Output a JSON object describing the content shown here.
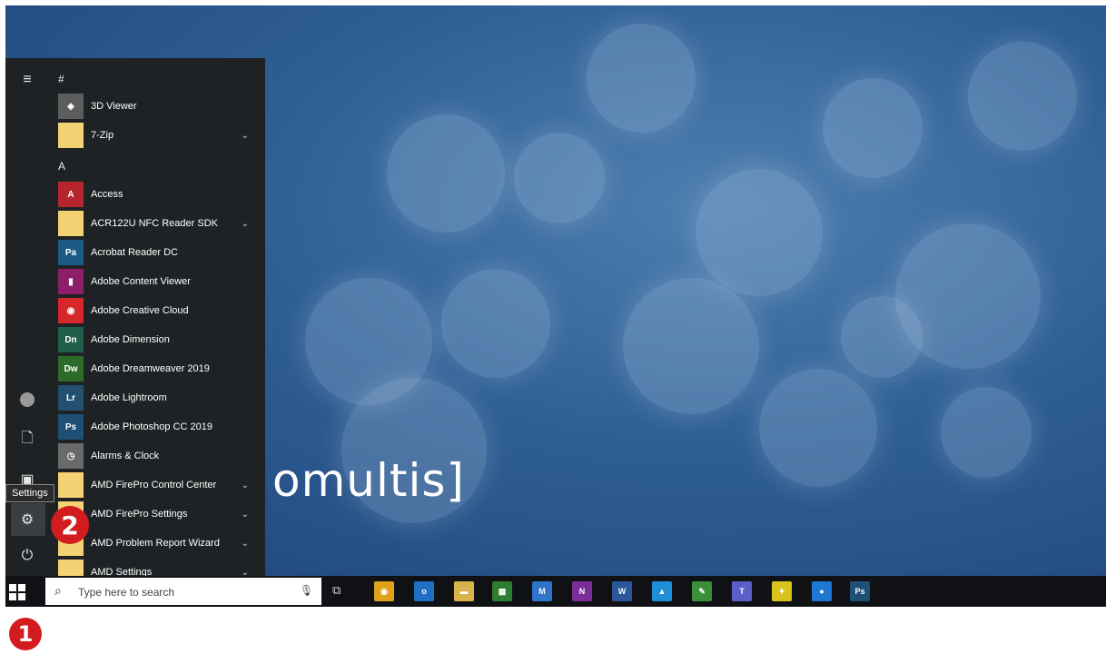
{
  "wallpaper": {
    "text": "omultis]"
  },
  "start_menu": {
    "rail": {
      "settings_tooltip": "Settings"
    },
    "groups": [
      {
        "header": "#",
        "apps": [
          {
            "label": "3D Viewer",
            "icon": "cube-icon",
            "color": "#5d5d5d",
            "glyph": "◈",
            "expandable": false
          },
          {
            "label": "7-Zip",
            "icon": "folder-icon",
            "color": "#f2d272",
            "glyph": "",
            "expandable": true
          }
        ]
      },
      {
        "header": "A",
        "apps": [
          {
            "label": "Access",
            "icon": "access-icon",
            "color": "#b7252c",
            "glyph": "A",
            "expandable": false
          },
          {
            "label": "ACR122U NFC Reader SDK",
            "icon": "folder-icon",
            "color": "#f2d272",
            "glyph": "",
            "expandable": true
          },
          {
            "label": "Acrobat Reader DC",
            "icon": "acrobat-icon",
            "color": "#1c5a86",
            "glyph": "Pa",
            "expandable": false
          },
          {
            "label": "Adobe Content Viewer",
            "icon": "content-viewer-icon",
            "color": "#8d1f6a",
            "glyph": "▮",
            "expandable": false
          },
          {
            "label": "Adobe Creative Cloud",
            "icon": "creative-cloud-icon",
            "color": "#d6272b",
            "glyph": "◉",
            "expandable": false
          },
          {
            "label": "Adobe Dimension",
            "icon": "dimension-icon",
            "color": "#1f5f4a",
            "glyph": "Dn",
            "expandable": false
          },
          {
            "label": "Adobe Dreamweaver 2019",
            "icon": "dreamweaver-icon",
            "color": "#2d6b2a",
            "glyph": "Dw",
            "expandable": false
          },
          {
            "label": "Adobe Lightroom",
            "icon": "lightroom-icon",
            "color": "#22506e",
            "glyph": "Lr",
            "expandable": false
          },
          {
            "label": "Adobe Photoshop CC 2019",
            "icon": "photoshop-icon",
            "color": "#1e4f75",
            "glyph": "Ps",
            "expandable": false
          },
          {
            "label": "Alarms & Clock",
            "icon": "clock-icon",
            "color": "#6a6a6a",
            "glyph": "◷",
            "expandable": false
          },
          {
            "label": "AMD FirePro Control Center",
            "icon": "folder-icon",
            "color": "#f2d272",
            "glyph": "",
            "expandable": true
          },
          {
            "label": "AMD FirePro Settings",
            "icon": "folder-icon",
            "color": "#f2d272",
            "glyph": "",
            "expandable": true
          },
          {
            "label": "AMD Problem Report Wizard",
            "icon": "folder-icon",
            "color": "#f2d272",
            "glyph": "",
            "expandable": true
          },
          {
            "label": "AMD Settings",
            "icon": "folder-icon",
            "color": "#f2d272",
            "glyph": "",
            "expandable": true
          }
        ]
      }
    ]
  },
  "taskbar": {
    "search_placeholder": "Type here to search",
    "pinned": [
      {
        "name": "chrome-icon",
        "color": "#e0a21b",
        "glyph": "◉"
      },
      {
        "name": "outlook-icon",
        "color": "#1f6fc4",
        "glyph": "o"
      },
      {
        "name": "file-explorer-icon",
        "color": "#d8b44a",
        "glyph": "▬"
      },
      {
        "name": "store-icon",
        "color": "#2e7d32",
        "glyph": "▦"
      },
      {
        "name": "visual-studio-icon",
        "color": "#2f74c8",
        "glyph": "M"
      },
      {
        "name": "onenote-icon",
        "color": "#7b2d99",
        "glyph": "N"
      },
      {
        "name": "word-icon",
        "color": "#2b579a",
        "glyph": "W"
      },
      {
        "name": "onedrive-icon",
        "color": "#1e8fd6",
        "glyph": "▲"
      },
      {
        "name": "pen-app-icon",
        "color": "#3b8f3b",
        "glyph": "✎"
      },
      {
        "name": "teams-icon",
        "color": "#5b5fc7",
        "glyph": "T"
      },
      {
        "name": "sticky-notes-icon",
        "color": "#d8c21e",
        "glyph": "✦"
      },
      {
        "name": "messaging-icon",
        "color": "#1e77d3",
        "glyph": "●"
      },
      {
        "name": "photoshop-taskbar-icon",
        "color": "#1e4f75",
        "glyph": "Ps"
      }
    ]
  },
  "annotations": {
    "step1": "1",
    "step2": "2",
    "badge_color": "#d31c1f"
  }
}
